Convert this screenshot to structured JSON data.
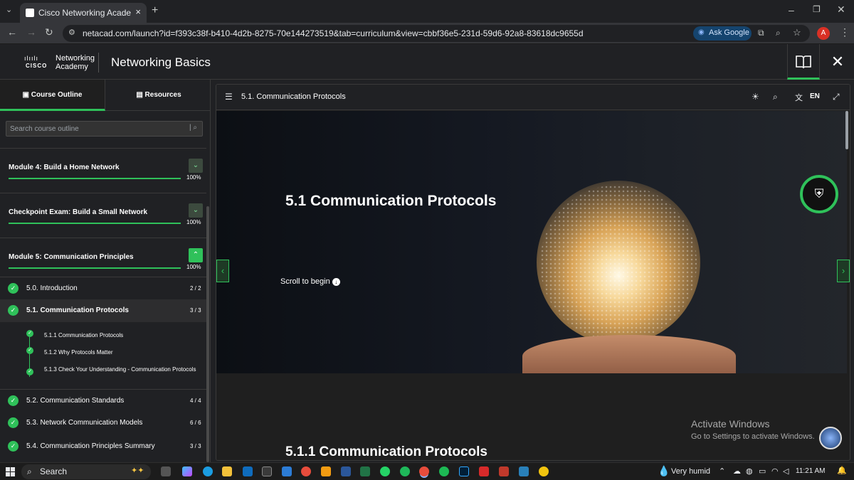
{
  "browser": {
    "tab_title": "Cisco Networking Academy: Ne",
    "url": "netacad.com/launch?id=f393c38f-b410-4d2b-8275-70e144273519&tab=curriculum&view=cbbf36e5-231d-59d6-92a8-83618dc9655d",
    "ask_google": "Ask Google",
    "avatar": "A"
  },
  "app": {
    "logo_line1": "Networking",
    "logo_line2": "Academy",
    "logo_brand": "CISCO",
    "title": "Networking Basics"
  },
  "sidebar": {
    "tab_outline": "Course Outline",
    "tab_resources": "Resources",
    "search_placeholder": "Search course outline",
    "modules": [
      {
        "title": "Module 4: Build a Home Network",
        "progress": "100%"
      },
      {
        "title": "Checkpoint Exam: Build a Small Network",
        "progress": "100%"
      },
      {
        "title": "Module 5: Communication Principles",
        "progress": "100%"
      }
    ],
    "sections": [
      {
        "title": "5.0. Introduction",
        "count": "2 / 2"
      },
      {
        "title": "5.1. Communication Protocols",
        "count": "3 / 3"
      },
      {
        "title": "5.2. Communication Standards",
        "count": "4 / 4"
      },
      {
        "title": "5.3. Network Communication Models",
        "count": "6 / 6"
      },
      {
        "title": "5.4. Communication Principles Summary",
        "count": "3 / 3"
      }
    ],
    "subsections": [
      {
        "title": "5.1.1 Communication Protocols"
      },
      {
        "title": "5.1.2 Why Protocols Matter"
      },
      {
        "title": "5.1.3 Check Your Understanding - Communication Protocols"
      }
    ]
  },
  "content": {
    "header_title": "5.1. Communication Protocols",
    "lang": "EN",
    "hero_title": "5.1 Communication Protocols",
    "scroll_begin": "Scroll to begin",
    "section_title": "5.1.1 Communication Protocols"
  },
  "overlay": {
    "activate_title": "Activate Windows",
    "activate_sub": "Go to Settings to activate Windows."
  },
  "taskbar": {
    "search": "Search",
    "weather": "Very humid",
    "time": "11:21 AM"
  },
  "colors": {
    "accent": "#2fc15a",
    "background": "#202124"
  }
}
